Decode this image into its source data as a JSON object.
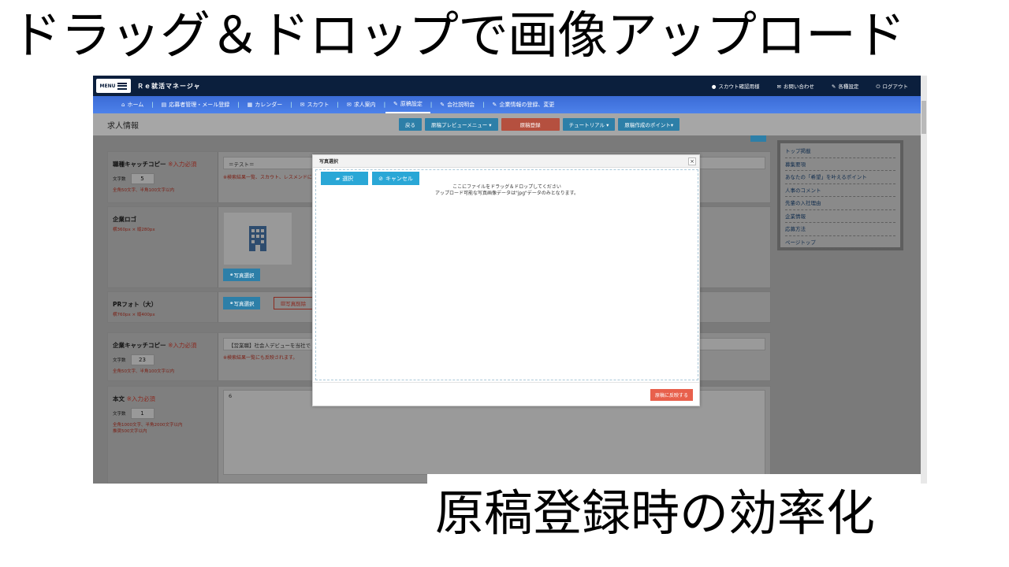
{
  "headline": "ドラッグ＆ドロップで画像アップロード",
  "subline": "原稿登録時の効率化",
  "app": {
    "menu_label": "MENU",
    "title": "Ｒｅ就活マネージャ",
    "top_links": [
      {
        "icon": "user-icon",
        "label": "スカウト確認用様"
      },
      {
        "icon": "mail-icon",
        "label": "お問い合わせ"
      },
      {
        "icon": "wrench-icon",
        "label": "各種設定"
      },
      {
        "icon": "logout-icon",
        "label": "ログアウト"
      }
    ]
  },
  "nav": {
    "items": [
      {
        "icon": "home-icon",
        "label": "ホーム"
      },
      {
        "icon": "list-icon",
        "label": "応募者管理・メール登録"
      },
      {
        "icon": "calendar-icon",
        "label": "カレンダー"
      },
      {
        "icon": "mail-icon",
        "label": "スカウト"
      },
      {
        "icon": "mail-icon",
        "label": "求人案内"
      },
      {
        "icon": "pencil-icon",
        "label": "原稿設定"
      },
      {
        "icon": "pencil-icon",
        "label": "会社説明会"
      },
      {
        "icon": "wrench-icon",
        "label": "企業情報の登録、変更"
      }
    ]
  },
  "page": {
    "title": "求人情報",
    "buttons": {
      "back": "戻る",
      "preview": "原稿プレビューメニュー ▾",
      "register": "原稿登録",
      "tutorial": "チュートリアル ▾",
      "points": "原稿作成のポイント▾"
    }
  },
  "form": {
    "catch_copy": {
      "label": "職種キャッチコピー",
      "required": "※入力必須",
      "count_label": "文字数",
      "count": "5",
      "hint": "全角50文字、半角100文字以内",
      "value": "＝テスト＝",
      "note": "※検索結果一覧、スカウト、レスメンドに"
    },
    "logo": {
      "label": "企業ロゴ",
      "size": "横360px × 縦280px",
      "select_photo": "写真選択"
    },
    "pr_photo": {
      "label": "PRフォト（大）",
      "size": "横760px × 縦400px",
      "select_photo": "写真選択",
      "delete_photo": "写真削除"
    },
    "company_catch": {
      "label": "企業キャッチコピー",
      "required": "※入力必須",
      "count_label": "文字数",
      "count": "23",
      "hint": "全角50文字、半角100文字以内",
      "value": "【営業職】社会人デビューを当社で",
      "note": "※検索結果一覧にも反映されます。"
    },
    "body": {
      "label": "本文",
      "required": "※入力必須",
      "count_label": "文字数",
      "count": "1",
      "hint1": "全角1000文字、半角2000文字以内",
      "hint2": "推奨500文字以内",
      "value": "6"
    }
  },
  "side_nav": [
    "トップ掲載",
    "募集要項",
    "あなたの「希望」を叶えるポイント",
    "人事のコメント",
    "先輩の入社理由",
    "企業情報",
    "応募方法",
    "ページトップ"
  ],
  "modal": {
    "title": "写真選択",
    "close": "×",
    "select": "選択",
    "cancel": "キャンセル",
    "drop_line1": "ここにファイルをドラッグ＆ドロップしてください",
    "drop_line2": "アップロード可能な写真画像データは\"jpg\"データのみとなります。",
    "apply": "原稿に反映する"
  }
}
